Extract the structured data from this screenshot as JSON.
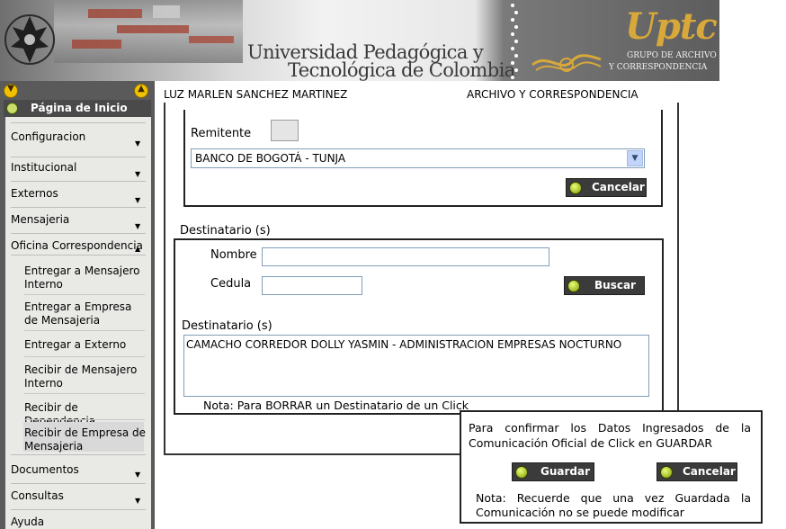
{
  "header": {
    "university_line1": "Universidad Pedagógica y",
    "university_line2": "Tecnológica de Colombia",
    "logo_text": "Uptc",
    "logo_sub1": "GRUPO DE ARCHIVO",
    "logo_sub2": "Y CORRESPONDENCIA"
  },
  "userbar": {
    "user_name": "LUZ MARLEN SANCHEZ MARTINEZ",
    "area": "ARCHIVO Y CORRESPONDENCIA"
  },
  "sidebar": {
    "home_label": "Página de Inicio",
    "items": [
      {
        "label": "Configuracion"
      },
      {
        "label": "Institucional"
      },
      {
        "label": "Externos"
      },
      {
        "label": "Mensajeria"
      },
      {
        "label": "Oficina Correspondencia"
      }
    ],
    "subitems": [
      {
        "label": "Entregar a Mensajero Interno"
      },
      {
        "label": "Entregar a Empresa de Mensajeria"
      },
      {
        "label": "Entregar a Externo"
      },
      {
        "label": "Recibir de Mensajero Interno"
      },
      {
        "label": "Recibir de Dependencia"
      },
      {
        "label": "Recibir de Empresa de Mensajeria"
      }
    ],
    "bottom_items": [
      {
        "label": "Documentos"
      },
      {
        "label": "Consultas"
      },
      {
        "label": "Ayuda"
      }
    ]
  },
  "remitente": {
    "label": "Remitente",
    "selected": "BANCO DE BOGOTÁ - TUNJA",
    "cancel_label": "Cancelar"
  },
  "destinatario": {
    "section_title": "Destinatario (s)",
    "nombre_label": "Nombre",
    "nombre_value": "",
    "cedula_label": "Cedula",
    "cedula_value": "",
    "search_label": "Buscar",
    "list_label": "Destinatario (s)",
    "list_value": "CAMACHO CORREDOR DOLLY YASMIN - ADMINISTRACION EMPRESAS NOCTURNO",
    "note": "Nota: Para BORRAR un Destinatario de un Click"
  },
  "confirm": {
    "message": "Para confirmar los Datos Ingresados de la Comunicación Oficial de Click en GUARDAR",
    "save_label": "Guardar",
    "cancel_label": "Cancelar",
    "note": "Nota: Recuerde que una vez Guardada la Comunicación no se puede modificar"
  },
  "colors": {
    "sidebar_bg": "#5a5a5a",
    "menu_bg": "#e9e9e6",
    "button_bg": "#3b3b3b",
    "led_green": "#b5d400",
    "logo_gold": "#d8a83a"
  }
}
